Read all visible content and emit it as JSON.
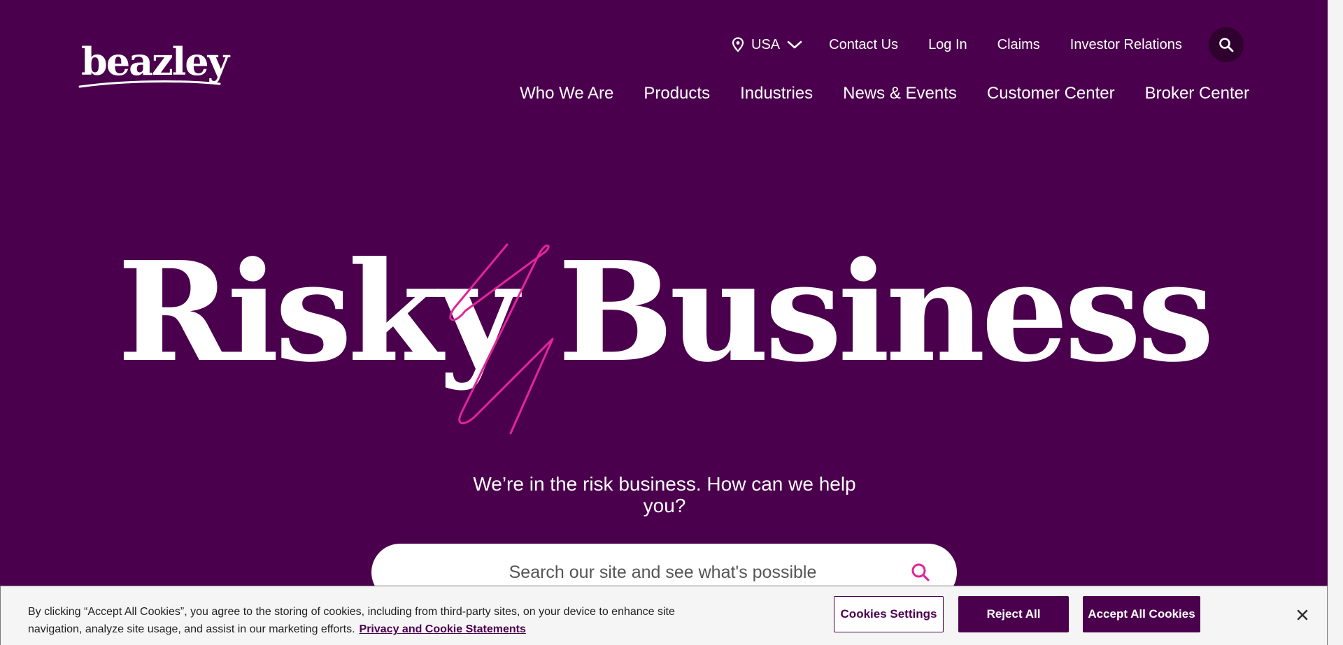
{
  "brand": {
    "logo_text": "beazley",
    "colors": {
      "primary": "#4b004d",
      "accent": "#e0259a",
      "text": "#ffffff"
    }
  },
  "utility_nav": {
    "country": {
      "icon": "map-pin-icon",
      "label": "USA",
      "chevron": "chevron-down-icon"
    },
    "links": [
      "Contact Us",
      "Log In",
      "Claims",
      "Investor Relations"
    ],
    "search_icon": "search-icon"
  },
  "main_nav": [
    "Who We Are",
    "Products",
    "Industries",
    "News & Events",
    "Customer Center",
    "Broker Center"
  ],
  "hero": {
    "title": "Risky Business",
    "tagline": "We’re in the risk business. How can we help you?",
    "search": {
      "placeholder": "Search our site and see what's possible",
      "icon": "search-icon"
    }
  },
  "cookie_banner": {
    "text": "By clicking “Accept All Cookies”, you agree to the storing of cookies, including from third-party sites, on your device to enhance site navigation, analyze site usage, and assist in our marketing efforts.",
    "link": "Privacy and Cookie Statements",
    "buttons": {
      "settings": "Cookies Settings",
      "reject": "Reject All",
      "accept": "Accept All Cookies"
    },
    "close_icon": "close-icon"
  }
}
